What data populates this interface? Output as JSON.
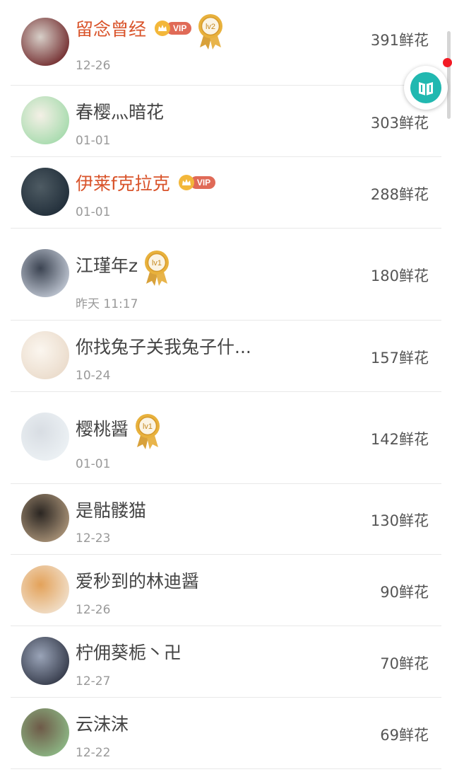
{
  "rows": [
    {
      "name": "留念曾经",
      "date": "12-26",
      "flowers": "391鲜花",
      "vip": true,
      "medal": "lv2",
      "avatar_colors": [
        "#6a1f22",
        "#d7cfc8"
      ]
    },
    {
      "name": "春樱灬暗花",
      "date": "01-01",
      "flowers": "303鲜花",
      "vip": false,
      "medal": "",
      "avatar_colors": [
        "#9fd9a8",
        "#f4f0e6"
      ]
    },
    {
      "name": "伊莱f克拉克",
      "date": "01-01",
      "flowers": "288鲜花",
      "vip": true,
      "medal": "",
      "avatar_colors": [
        "#1d2a36",
        "#4e5b63"
      ]
    },
    {
      "name": "江瑾年z",
      "date": "昨天 11:17",
      "flowers": "180鲜花",
      "vip": false,
      "medal": "lv1",
      "avatar_colors": [
        "#c9d0dc",
        "#3c4452"
      ]
    },
    {
      "name": "你找兔子关我兔子什...",
      "date": "10-24",
      "flowers": "157鲜花",
      "vip": false,
      "medal": "",
      "avatar_colors": [
        "#e9d9c8",
        "#fbf6ef"
      ]
    },
    {
      "name": "樱桃醤",
      "date": "01-01",
      "flowers": "142鲜花",
      "vip": false,
      "medal": "lv1",
      "avatar_colors": [
        "#eef3f6",
        "#d8dde3"
      ]
    },
    {
      "name": "是骷髅猫",
      "date": "12-23",
      "flowers": "130鲜花",
      "vip": false,
      "medal": "",
      "avatar_colors": [
        "#b39b7e",
        "#2b2622"
      ]
    },
    {
      "name": "爱秒到的林迪醤",
      "date": "12-26",
      "flowers": "90鲜花",
      "vip": false,
      "medal": "",
      "avatar_colors": [
        "#f2e4d3",
        "#e3a25a"
      ]
    },
    {
      "name": "柠佣葵栀丶卍",
      "date": "12-27",
      "flowers": "70鲜花",
      "vip": false,
      "medal": "",
      "avatar_colors": [
        "#2c3140",
        "#9aa4b8"
      ]
    },
    {
      "name": "云沫沫",
      "date": "12-22",
      "flowers": "69鲜花",
      "vip": false,
      "medal": "",
      "avatar_colors": [
        "#8fbf8a",
        "#6e5a48"
      ]
    }
  ],
  "vip_label": "VIP",
  "colors": {
    "vip_name": "#d9542b",
    "accent_teal": "#21b8b0",
    "notification_dot": "#f21a24"
  },
  "floating_button": {
    "icon": "book-icon"
  }
}
